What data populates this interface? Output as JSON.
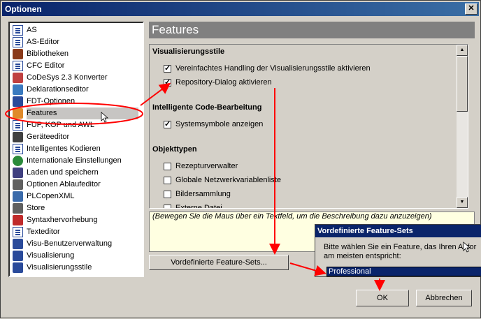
{
  "window": {
    "title": "Optionen",
    "close_label": "✕"
  },
  "tree": {
    "items": [
      {
        "label": "AS",
        "icon": "doc-icon",
        "color": "#2a4a9a"
      },
      {
        "label": "AS-Editor",
        "icon": "doc-icon",
        "color": "#2a4a9a"
      },
      {
        "label": "Bibliotheken",
        "icon": "books-icon",
        "color": "#8a3a1a"
      },
      {
        "label": "CFC Editor",
        "icon": "doc-icon",
        "color": "#2a4a9a"
      },
      {
        "label": "CoDeSys 2.3 Konverter",
        "icon": "converter-icon",
        "color": "#c04040"
      },
      {
        "label": "Deklarationseditor",
        "icon": "pencil-icon",
        "color": "#3a7abf"
      },
      {
        "label": "FDT-Optionen",
        "icon": "fdt-icon",
        "color": "#2a4a9a"
      },
      {
        "label": "Features",
        "icon": "features-icon",
        "color": "#e08a2a"
      },
      {
        "label": "FUP, KOP und AWL",
        "icon": "doc-icon",
        "color": "#2a4a9a"
      },
      {
        "label": "Geräteeditor",
        "icon": "device-icon",
        "color": "#404040"
      },
      {
        "label": "Intelligentes Kodieren",
        "icon": "doc-icon",
        "color": "#2a4a9a"
      },
      {
        "label": "Internationale Einstellungen",
        "icon": "globe-icon",
        "color": "#2a8a3a"
      },
      {
        "label": "Laden und speichern",
        "icon": "save-icon",
        "color": "#404080"
      },
      {
        "label": "Optionen Ablaufeditor",
        "icon": "gear-icon",
        "color": "#606060"
      },
      {
        "label": "PLCopenXML",
        "icon": "xml-icon",
        "color": "#3a6aaa"
      },
      {
        "label": "Store",
        "icon": "store-icon",
        "color": "#606060"
      },
      {
        "label": "Syntaxhervorhebung",
        "icon": "syntax-icon",
        "color": "#c02a2a"
      },
      {
        "label": "Texteditor",
        "icon": "doc-icon",
        "color": "#2a4a9a"
      },
      {
        "label": "Visu-Benutzerverwaltung",
        "icon": "users-icon",
        "color": "#2a4a9a"
      },
      {
        "label": "Visualisierung",
        "icon": "visu-icon",
        "color": "#2a4a9a"
      },
      {
        "label": "Visualisierungsstile",
        "icon": "visu-icon",
        "color": "#2a4a9a"
      }
    ],
    "selected_index": 7
  },
  "header": {
    "title": "Features"
  },
  "features": {
    "sections": [
      {
        "title": "Visualisierungsstile",
        "items": [
          {
            "label": "Vereinfachtes Handling der Visualisierungsstile aktivieren",
            "checked": true
          },
          {
            "label": "Repository-Dialog aktivieren",
            "checked": true
          }
        ]
      },
      {
        "title": "Intelligente Code-Bearbeitung",
        "items": [
          {
            "label": "Systemsymbole anzeigen",
            "checked": true
          }
        ]
      },
      {
        "title": "Objekttypen",
        "items": [
          {
            "label": "Rezepturverwalter",
            "checked": false
          },
          {
            "label": "Globale Netzwerkvariablenliste",
            "checked": false
          },
          {
            "label": "Bildersammlung",
            "checked": false
          },
          {
            "label": "Externe Datei",
            "checked": false
          }
        ]
      }
    ]
  },
  "description": {
    "text": "(Bewegen Sie die Maus über ein Textfeld, um die Beschreibung dazu anzuzeigen)"
  },
  "buttons": {
    "predefined": "Vordefinierte Feature-Sets...",
    "ok": "OK",
    "cancel": "Abbrechen"
  },
  "popup": {
    "title": "Vordefinierte Feature-Sets",
    "message": "Bitte wählen Sie ein Feature, das Ihren Anfor\nam meisten entspricht:",
    "selected_value": "Professional"
  },
  "colors": {
    "annotation": "#ff0000",
    "title_bar": "#0a246a",
    "selection": "#0a246a"
  }
}
